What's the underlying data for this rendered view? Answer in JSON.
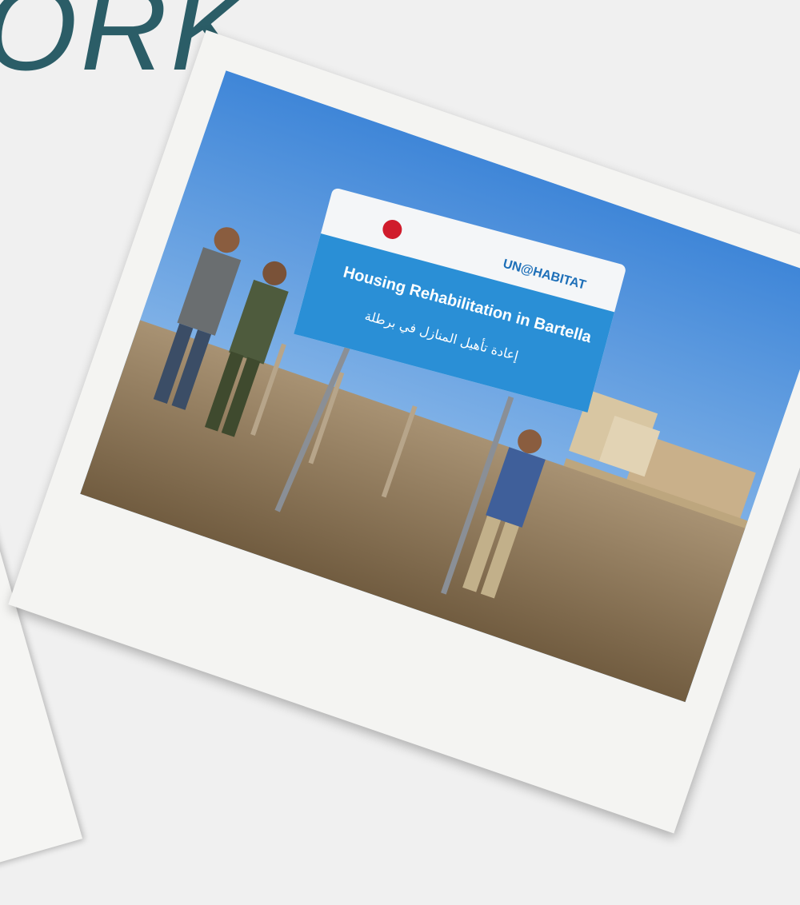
{
  "headline": {
    "text": "ORK"
  },
  "sign": {
    "logo_text": "UN@HABITAT",
    "title": "Housing Rehabilitation in Bartella",
    "arabic_title": "إعادة تأهيل المنازل في برطلة"
  },
  "colors": {
    "headline": "#2b5d67",
    "sky": "#5a9be0",
    "sign_blue": "#2a8fd6",
    "ground": "#9a8466"
  }
}
